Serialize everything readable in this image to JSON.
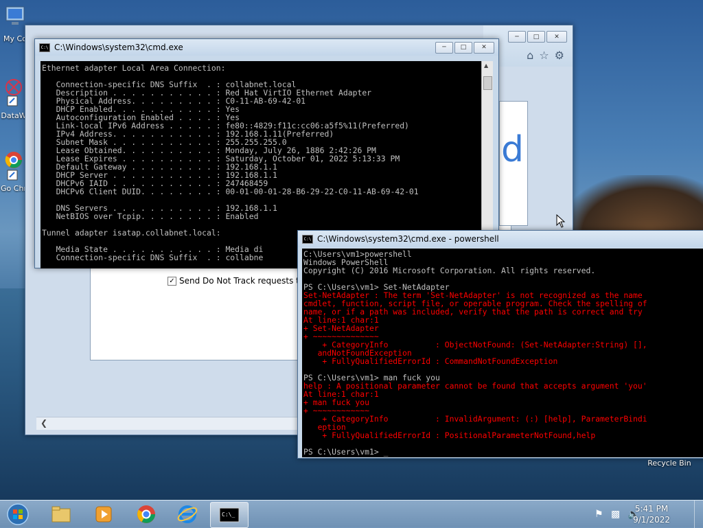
{
  "desktop": {
    "icons": [
      {
        "label": "My Co"
      },
      {
        "label": "DataW"
      },
      {
        "label": "Go Chr"
      },
      {
        "label": "Recycle Bin"
      }
    ]
  },
  "ie_window": {
    "dnt_label": "Send Do Not Track requests to tel",
    "fragment_text": "d"
  },
  "cmd1": {
    "title": "C:\\Windows\\system32\\cmd.exe",
    "lines": [
      "Ethernet adapter Local Area Connection:",
      "",
      "   Connection-specific DNS Suffix  . : collabnet.local",
      "   Description . . . . . . . . . . . : Red Hat VirtIO Ethernet Adapter",
      "   Physical Address. . . . . . . . . : C0-11-AB-69-42-01",
      "   DHCP Enabled. . . . . . . . . . . : Yes",
      "   Autoconfiguration Enabled . . . . : Yes",
      "   Link-local IPv6 Address . . . . . : fe80::4829:f11c:cc06:a5f5%11(Preferred)",
      "   IPv4 Address. . . . . . . . . . . : 192.168.1.11(Preferred)",
      "   Subnet Mask . . . . . . . . . . . : 255.255.255.0",
      "   Lease Obtained. . . . . . . . . . : Monday, July 26, 1886 2:42:26 PM",
      "   Lease Expires . . . . . . . . . . : Saturday, October 01, 2022 5:13:33 PM",
      "   Default Gateway . . . . . . . . . : 192.168.1.1",
      "   DHCP Server . . . . . . . . . . . : 192.168.1.1",
      "   DHCPv6 IAID . . . . . . . . . . . : 247468459",
      "   DHCPv6 Client DUID. . . . . . . . : 00-01-00-01-28-B6-29-22-C0-11-AB-69-42-01",
      "",
      "   DNS Servers . . . . . . . . . . . : 192.168.1.1",
      "   NetBIOS over Tcpip. . . . . . . . : Enabled",
      "",
      "Tunnel adapter isatap.collabnet.local:",
      "",
      "   Media State . . . . . . . . . . . : Media di",
      "   Connection-specific DNS Suffix  . : collabne"
    ]
  },
  "cmd2": {
    "title": "C:\\Windows\\system32\\cmd.exe - powershell",
    "lines": [
      {
        "t": "C:\\Users\\vm1>powershell",
        "c": "white"
      },
      {
        "t": "Windows PowerShell",
        "c": "white"
      },
      {
        "t": "Copyright (C) 2016 Microsoft Corporation. All rights reserved.",
        "c": "white"
      },
      {
        "t": "",
        "c": "white"
      },
      {
        "t": "PS C:\\Users\\vm1> Set-NetAdapter",
        "c": "white"
      },
      {
        "t": "Set-NetAdapter : The term 'Set-NetAdapter' is not recognized as the name",
        "c": "red"
      },
      {
        "t": "cmdlet, function, script file, or operable program. Check the spelling of",
        "c": "red"
      },
      {
        "t": "name, or if a path was included, verify that the path is correct and try",
        "c": "red"
      },
      {
        "t": "At line:1 char:1",
        "c": "red"
      },
      {
        "t": "+ Set-NetAdapter",
        "c": "red"
      },
      {
        "t": "+ ~~~~~~~~~~~~~~",
        "c": "red"
      },
      {
        "t": "    + CategoryInfo          : ObjectNotFound: (Set-NetAdapter:String) [],",
        "c": "red"
      },
      {
        "t": "   andNotFoundException",
        "c": "red"
      },
      {
        "t": "    + FullyQualifiedErrorId : CommandNotFoundException",
        "c": "red"
      },
      {
        "t": "",
        "c": "white"
      },
      {
        "t": "PS C:\\Users\\vm1> man fuck you",
        "c": "white"
      },
      {
        "t": "help : A positional parameter cannot be found that accepts argument 'you'",
        "c": "red"
      },
      {
        "t": "At line:1 char:1",
        "c": "red"
      },
      {
        "t": "+ man fuck you",
        "c": "red"
      },
      {
        "t": "+ ~~~~~~~~~~~~",
        "c": "red"
      },
      {
        "t": "    + CategoryInfo          : InvalidArgument: (:) [help], ParameterBindi",
        "c": "red"
      },
      {
        "t": "   eption",
        "c": "red"
      },
      {
        "t": "    + FullyQualifiedErrorId : PositionalParameterNotFound,help",
        "c": "red"
      },
      {
        "t": "",
        "c": "white"
      },
      {
        "t": "PS C:\\Users\\vm1> _",
        "c": "white"
      }
    ]
  },
  "taskbar": {
    "items": [
      "start-orb",
      "explorer",
      "media-player",
      "chrome",
      "internet-explorer",
      "cmd"
    ],
    "time": "5:41 PM",
    "date": "9/1/2022"
  },
  "colors": {
    "console_text": "#c0c0c0",
    "console_error": "#ff0000",
    "titlebar": "#c3d6ea"
  }
}
